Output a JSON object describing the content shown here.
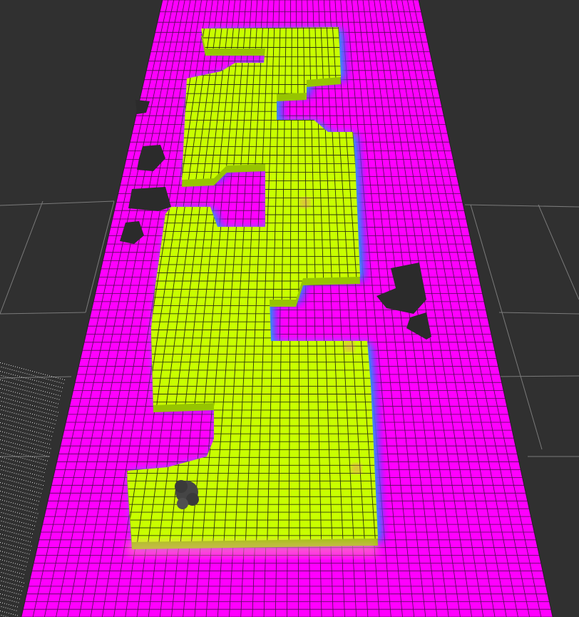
{
  "colors": {
    "background": "#303030",
    "reference_grid_line": "#7a7a7a",
    "free_cell": "#ff00ff",
    "occupied_cell": "#c8ff00",
    "cell_edge": "#111111",
    "obstacle": "#2b2b2b",
    "point_cloud": "#dcdcdc",
    "gradient_low": "#7f00ff",
    "gradient_mid": "#00e5ff",
    "gradient_high": "#c8ff00"
  },
  "layers": [
    {
      "id": "reference-grid",
      "kind": "ground reference grid"
    },
    {
      "id": "costmap",
      "kind": "2.5D occupancy / cost map"
    },
    {
      "id": "obstacles",
      "kind": "dark obstacle blobs"
    },
    {
      "id": "point-cloud",
      "kind": "sparse point cloud"
    }
  ],
  "icons": {
    "obstacle": "dark-blob-icon",
    "robot": "robot-footprint-icon"
  }
}
